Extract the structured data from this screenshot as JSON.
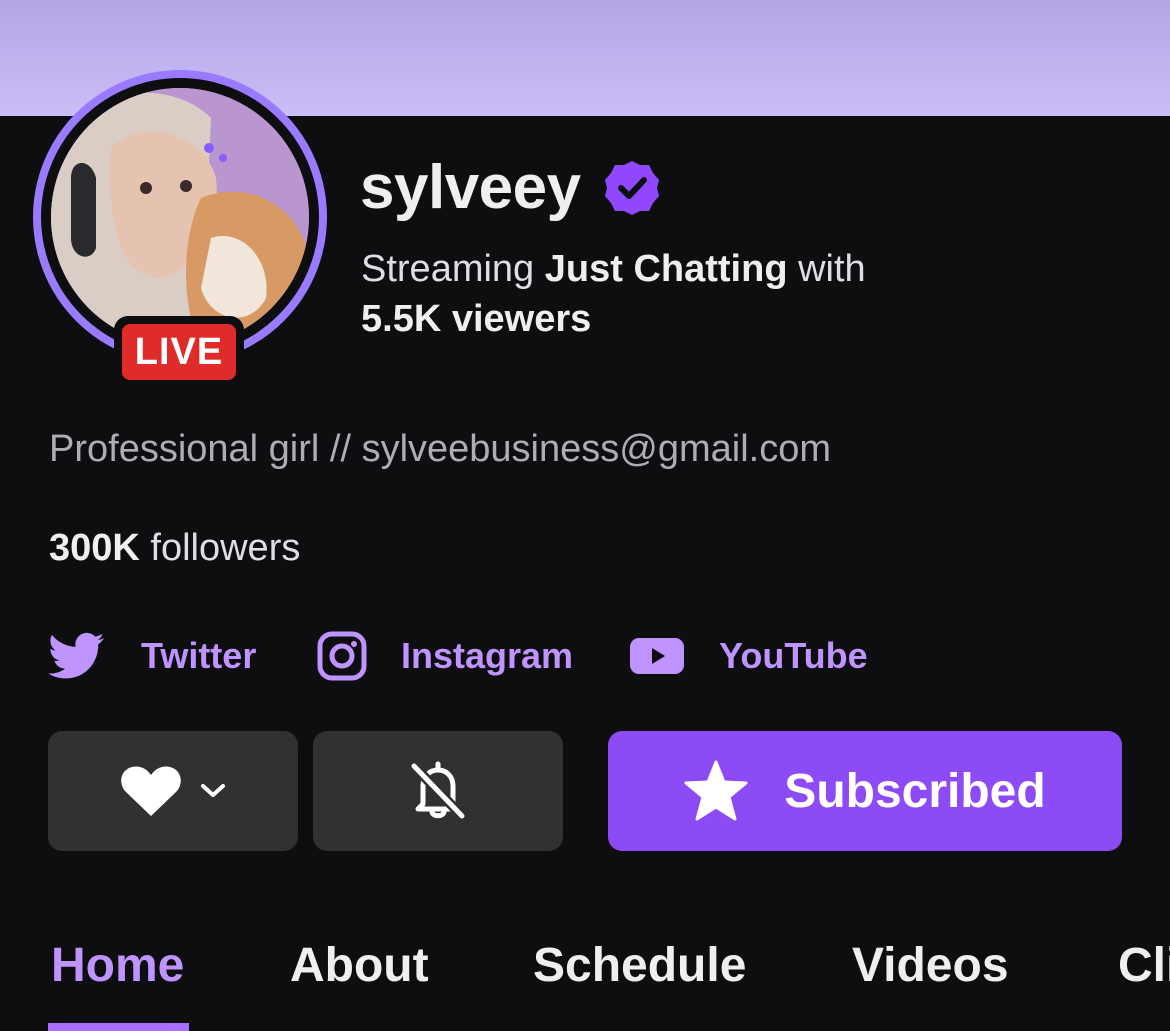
{
  "channel": {
    "name": "sylveey",
    "live_label": "LIVE",
    "stream_prefix": "Streaming",
    "category": "Just Chatting",
    "stream_suffix": "with",
    "viewers": "5.5K viewers",
    "bio": "Professional girl // sylveebusiness@gmail.com",
    "followers_count": "300K",
    "followers_label": "followers"
  },
  "socials": [
    {
      "label": "Twitter",
      "icon": "twitter-icon"
    },
    {
      "label": "Instagram",
      "icon": "instagram-icon"
    },
    {
      "label": "YouTube",
      "icon": "youtube-icon"
    }
  ],
  "actions": {
    "follow_icon": "heart-icon",
    "notifications_icon": "bell-off-icon",
    "subscribe_label": "Subscribed",
    "subscribe_icon": "star-icon"
  },
  "tabs": [
    {
      "label": "Home",
      "active": true
    },
    {
      "label": "About",
      "active": false
    },
    {
      "label": "Schedule",
      "active": false
    },
    {
      "label": "Videos",
      "active": false
    },
    {
      "label": "Cli",
      "active": false
    }
  ],
  "colors": {
    "accent": "#9147ff",
    "accent_text": "#bf94ff",
    "live": "#e02b2b",
    "background": "#0e0e10",
    "button_dark": "#313134",
    "banner": "#c4b5f5"
  }
}
